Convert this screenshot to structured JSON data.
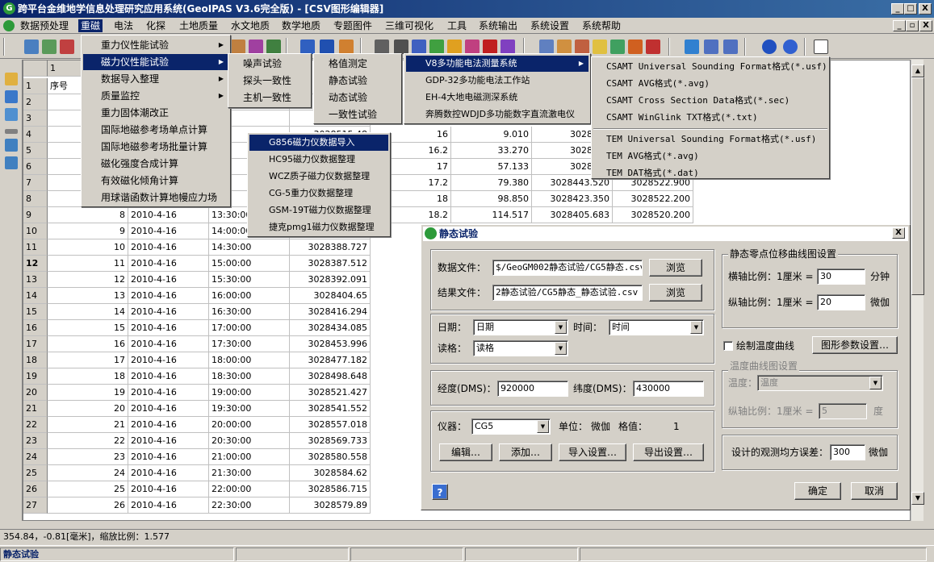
{
  "window": {
    "title": "跨平台金维地学信息处理研究应用系统(GeoIPAS V3.6完全版) - [CSV图形编辑器]",
    "min_glyph": "_",
    "max_glyph": "□",
    "close_glyph": "X",
    "restore_glyph": "▫"
  },
  "menubar": [
    "数据预处理",
    "重磁",
    "电法",
    "化探",
    "土地质量",
    "水文地质",
    "数学地质",
    "专题图件",
    "三维可视化",
    "工具",
    "系统输出",
    "系统设置",
    "系统帮助"
  ],
  "grid": {
    "col_header": "1",
    "header_cell": "序号",
    "top_rows": [
      {
        "row": "1"
      },
      {
        "row": "2"
      },
      {
        "row": "3",
        "time": "0:00"
      },
      {
        "row": "4",
        "time": "0:00",
        "v": "3028515.48"
      },
      {
        "row": "5",
        "time": "0:00"
      },
      {
        "row": "6",
        "time": "0:00"
      },
      {
        "row": "7",
        "time": "0:00"
      },
      {
        "row": "8",
        "time": "0:00"
      }
    ],
    "right_rows": [
      {
        "a": "16",
        "b": "9.010",
        "c": "3028515",
        "d": ""
      },
      {
        "a": "16.2",
        "b": "33.270",
        "c": "3028488",
        "d": ""
      },
      {
        "a": "17",
        "b": "57.133",
        "c": "3028464",
        "d": ""
      },
      {
        "a": "17.2",
        "b": "79.380",
        "c": "3028443.520",
        "d": "3028522.900"
      },
      {
        "a": "18",
        "b": "98.850",
        "c": "3028423.350",
        "d": "3028522.200"
      },
      {
        "a": "18.2",
        "b": "114.517",
        "c": "3028405.683",
        "d": "3028520.200"
      }
    ],
    "rows": [
      {
        "row": "9",
        "n": "8",
        "date": "2010-4-16",
        "time": "13:30:00",
        "v": ""
      },
      {
        "row": "10",
        "n": "9",
        "date": "2010-4-16",
        "time": "14:00:00",
        "v": ""
      },
      {
        "row": "11",
        "n": "10",
        "date": "2010-4-16",
        "time": "14:30:00",
        "v": "3028388.727"
      },
      {
        "row": "12",
        "n": "11",
        "date": "2010-4-16",
        "time": "15:00:00",
        "v": "3028387.512"
      },
      {
        "row": "13",
        "n": "12",
        "date": "2010-4-16",
        "time": "15:30:00",
        "v": "3028392.091"
      },
      {
        "row": "14",
        "n": "13",
        "date": "2010-4-16",
        "time": "16:00:00",
        "v": "3028404.65"
      },
      {
        "row": "15",
        "n": "14",
        "date": "2010-4-16",
        "time": "16:30:00",
        "v": "3028416.294"
      },
      {
        "row": "16",
        "n": "15",
        "date": "2010-4-16",
        "time": "17:00:00",
        "v": "3028434.085"
      },
      {
        "row": "17",
        "n": "16",
        "date": "2010-4-16",
        "time": "17:30:00",
        "v": "3028453.996"
      },
      {
        "row": "18",
        "n": "17",
        "date": "2010-4-16",
        "time": "18:00:00",
        "v": "3028477.182"
      },
      {
        "row": "19",
        "n": "18",
        "date": "2010-4-16",
        "time": "18:30:00",
        "v": "3028498.648"
      },
      {
        "row": "20",
        "n": "19",
        "date": "2010-4-16",
        "time": "19:00:00",
        "v": "3028521.427"
      },
      {
        "row": "21",
        "n": "20",
        "date": "2010-4-16",
        "time": "19:30:00",
        "v": "3028541.552"
      },
      {
        "row": "22",
        "n": "21",
        "date": "2010-4-16",
        "time": "20:00:00",
        "v": "3028557.018"
      },
      {
        "row": "23",
        "n": "22",
        "date": "2010-4-16",
        "time": "20:30:00",
        "v": "3028569.733"
      },
      {
        "row": "24",
        "n": "23",
        "date": "2010-4-16",
        "time": "21:00:00",
        "v": "3028580.558"
      },
      {
        "row": "25",
        "n": "24",
        "date": "2010-4-16",
        "time": "21:30:00",
        "v": "3028584.62"
      },
      {
        "row": "26",
        "n": "25",
        "date": "2010-4-16",
        "time": "22:00:00",
        "v": "3028586.715"
      },
      {
        "row": "27",
        "n": "26",
        "date": "2010-4-16",
        "time": "22:30:00",
        "v": "3028579.89"
      }
    ]
  },
  "menu1": [
    "重力仪性能试验",
    "磁力仪性能试验",
    "数据导入整理",
    "质量监控",
    "重力固体潮改正",
    "国际地磁参考场单点计算",
    "国际地磁参考场批量计算",
    "磁化强度合成计算",
    "有效磁化倾角计算",
    "用球谐函数计算地幔应力场"
  ],
  "menu2": [
    "噪声试验",
    "探头一致性",
    "主机一致性"
  ],
  "menu3": [
    "格值测定",
    "静态试验",
    "动态试验",
    "一致性试验"
  ],
  "menu4": [
    "G856磁力仪数据导入",
    "HC95磁力仪数据整理",
    "WCZ质子磁力仪数据整理",
    "CG-5重力仪数据整理",
    "GSM-19T磁力仪数据整理",
    "捷克pmg1磁力仪数据整理"
  ],
  "menu5": [
    "V8多功能电法测量系统",
    "GDP-32多功能电法工作站",
    "EH-4大地电磁测深系统",
    "奔腾数控WDJD多功能数字直流激电仪"
  ],
  "menu6": [
    "CSAMT Universal Sounding Format格式(*.usf)",
    "CSAMT AVG格式(*.avg)",
    "CSAMT Cross Section Data格式(*.sec)",
    "CSAMT WinGlink TXT格式(*.txt)",
    "TEM Universal Sounding Format格式(*.usf)",
    "TEM AVG格式(*.avg)",
    "TEM DAT格式(*.dat)"
  ],
  "dialog": {
    "title": "静态试验",
    "data_file_label": "数据文件：",
    "data_file_value": "$/GeoGM002静态试验/CG5静态.csv",
    "result_file_label": "结果文件：",
    "result_file_value": "2静态试验/CG5静态_静态试验.csv",
    "browse": "浏览",
    "date_label": "日期：",
    "date_value": "日期",
    "time_label": "时间：",
    "time_value": "时间",
    "reading_label": "读格：",
    "reading_value": "读格",
    "lon_label": "经度(DMS)：",
    "lon_value": "920000",
    "lat_label": "纬度(DMS)：",
    "lat_value": "430000",
    "instrument_label": "仪器：",
    "instrument_value": "CG5",
    "unit_label": "单位：",
    "unit_value": "微伽",
    "scale_label": "格值：",
    "scale_value": "1",
    "edit_btn": "编辑…",
    "add_btn": "添加…",
    "import_btn": "导入设置…",
    "export_btn": "导出设置…",
    "group1_title": "静态零点位移曲线图设置",
    "xscale_label": "横轴比例：1厘米 =",
    "xscale_value": "30",
    "xscale_unit": "分钟",
    "yscale_label": "纵轴比例：1厘米 =",
    "yscale_value": "20",
    "yscale_unit": "微伽",
    "temp_check_label": "绘制温度曲线",
    "graph_params_btn": "图形参数设置…",
    "group2_title": "温度曲线图设置",
    "temp_label": "温度：",
    "temp_value": "温度",
    "temp_yscale_label": "纵轴比例：1厘米 =",
    "temp_yscale_value": "5",
    "temp_yscale_unit": "度",
    "error_label": "设计的观测均方误差：",
    "error_value": "300",
    "error_unit": "微伽",
    "ok": "确定",
    "cancel": "取消",
    "help": "?",
    "close": "X"
  },
  "status": {
    "coords": "354.84，-0.81[毫米]，缩放比例：1.577",
    "panel": "静态试验"
  }
}
